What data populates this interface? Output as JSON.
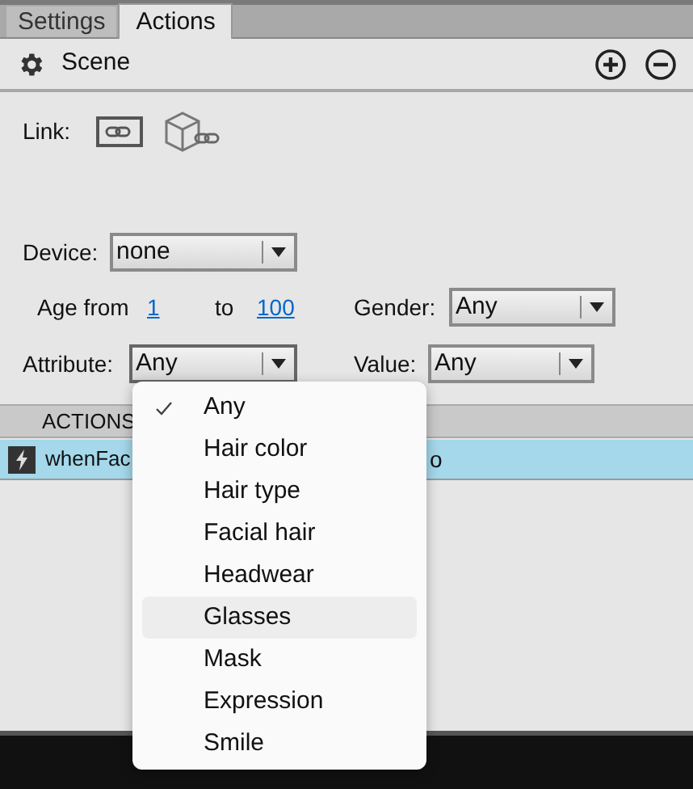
{
  "tabs": [
    {
      "label": "Settings",
      "selected": false
    },
    {
      "label": "Actions",
      "selected": true
    }
  ],
  "toolbar": {
    "title": "Scene"
  },
  "link": {
    "label": "Link:"
  },
  "device": {
    "label": "Device:",
    "value": "none"
  },
  "age": {
    "label": "Age from",
    "from": "1",
    "to_label": "to",
    "to": "100"
  },
  "gender": {
    "label": "Gender:",
    "value": "Any"
  },
  "attribute": {
    "label": "Attribute:",
    "value": "Any",
    "expanded": true
  },
  "value": {
    "label": "Value:",
    "value": "Any"
  },
  "actions": {
    "header": "ACTIONS",
    "rows": [
      {
        "text": "whenFac",
        "text_tail": "o",
        "selected": true
      }
    ]
  },
  "menu": {
    "items": [
      {
        "label": "Any",
        "selected": true,
        "hovered": false
      },
      {
        "label": "Hair color",
        "selected": false,
        "hovered": false
      },
      {
        "label": "Hair type",
        "selected": false,
        "hovered": false
      },
      {
        "label": "Facial hair",
        "selected": false,
        "hovered": false
      },
      {
        "label": "Headwear",
        "selected": false,
        "hovered": false
      },
      {
        "label": "Glasses",
        "selected": false,
        "hovered": true
      },
      {
        "label": "Mask",
        "selected": false,
        "hovered": false
      },
      {
        "label": "Expression",
        "selected": false,
        "hovered": false
      },
      {
        "label": "Smile",
        "selected": false,
        "hovered": false
      }
    ]
  }
}
